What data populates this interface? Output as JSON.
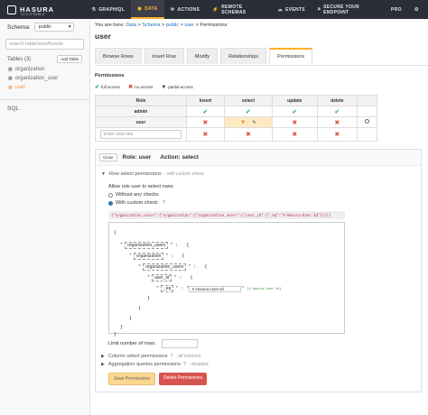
{
  "brand": {
    "name": "HASURA",
    "version": "v1.2.0-beta.2"
  },
  "nav": {
    "items": [
      {
        "label": "GRAPHIQL",
        "icon": "flask-icon"
      },
      {
        "label": "DATA",
        "icon": "database-icon",
        "active": true
      },
      {
        "label": "ACTIONS",
        "icon": "cog-icon"
      },
      {
        "label": "REMOTE SCHEMAS",
        "icon": "plug-icon"
      },
      {
        "label": "EVENTS",
        "icon": "cloud-icon"
      }
    ],
    "secure_label": "SECURE YOUR ENDPOINT",
    "pro_label": "PRO"
  },
  "sidebar": {
    "schema_label": "Schema:",
    "schema_value": "public",
    "search_placeholder": "search table/view/functio",
    "tables_title": "Tables (3)",
    "add_table_label": "Add Table",
    "tables": [
      "organization",
      "organization_user",
      "user"
    ],
    "sql_label": "SQL"
  },
  "main": {
    "breadcrumb": {
      "prefix": "You are here:",
      "items": [
        "Data",
        "Schema",
        "public",
        "user",
        "Permissions"
      ]
    },
    "table_name": "user",
    "tabs": [
      "Browse Rows",
      "Insert Row",
      "Modify",
      "Relationships",
      "Permissions"
    ],
    "permissions_title": "Permissions",
    "legend": {
      "full": "full access",
      "none": "no access",
      "partial": "partial access"
    },
    "table_headers": [
      "Role",
      "insert",
      "select",
      "update",
      "delete"
    ],
    "roles": [
      "admin",
      "user"
    ],
    "new_role_placeholder": "Enter new role"
  },
  "editor": {
    "close_label": "Close",
    "role_text": "Role: user",
    "action_text": "Action: select",
    "row_perm_label": "Row select permissions",
    "row_perm_hint": "- with custom check",
    "allow_text": "Allow role user to select rows:",
    "radio_without": "Without any checks",
    "radio_custom": "With custom check:",
    "code_text": "{\"organization_users\":{\"organization\":{\"organization_users\":{\"user_id\":{\"_eq\":\"X-Hasura-User-Id\"}}}}}",
    "builder": {
      "k1": "organization_users",
      "k2": "organization",
      "k3": "organization_users",
      "k4": "user_id",
      "op": "_eq",
      "val": "X-Hasura-User-Id",
      "session_hint": "[X-Hasura-User-Id]"
    },
    "limit_label": "Limit number of rows:",
    "col_perm_label": "Column select permissions",
    "col_perm_hint": "- all columns",
    "agg_perm_label": "Aggregation queries permissions",
    "agg_perm_hint": "- disabled",
    "save_label": "Save Permissions",
    "delete_label": "Delete Permissions"
  }
}
